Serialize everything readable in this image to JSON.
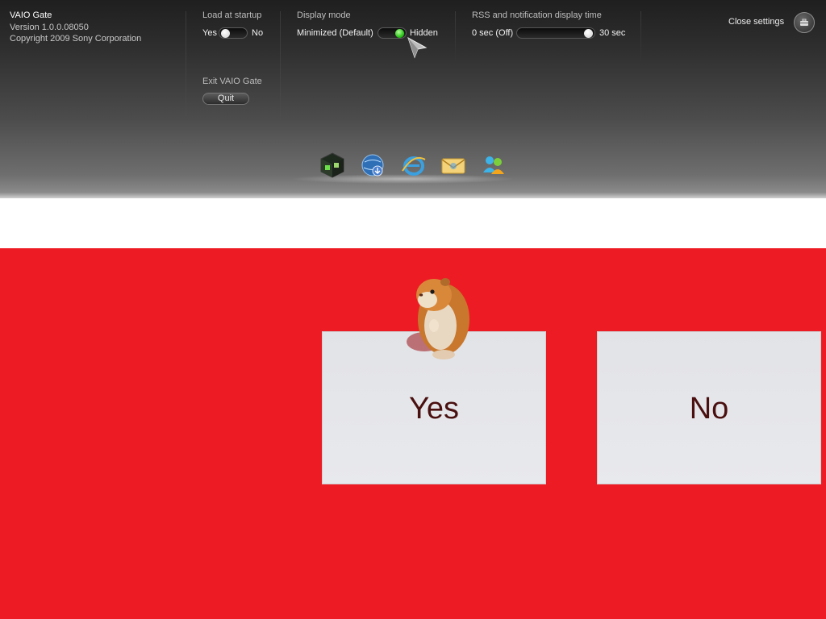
{
  "app_info": {
    "name": "VAIO Gate",
    "version": "Version 1.0.0.08050",
    "copyright": "Copyright 2009 Sony Corporation"
  },
  "settings": {
    "load_at_startup": {
      "label": "Load at startup",
      "on_label": "Yes",
      "off_label": "No",
      "value": "Yes"
    },
    "display_mode": {
      "label": "Display mode",
      "left_label": "Minimized (Default)",
      "right_label": "Hidden",
      "value": "Hidden"
    },
    "rss_time": {
      "label": "RSS and notification display time",
      "min_label": "0 sec (Off)",
      "max_label": "30 sec",
      "value_fraction": 1.0
    },
    "exit": {
      "label": "Exit VAIO Gate",
      "button": "Quit"
    },
    "close": {
      "label": "Close settings"
    }
  },
  "dock": {
    "icons": [
      "media-cube-icon",
      "globe-download-icon",
      "internet-explorer-icon",
      "mail-icon",
      "messenger-icon"
    ]
  },
  "content": {
    "yes_button": "Yes",
    "no_button": "No"
  },
  "colors": {
    "stage_background": "#ed1c24",
    "answer_text": "#4a1010",
    "toggle_active": "#2cc51a"
  }
}
